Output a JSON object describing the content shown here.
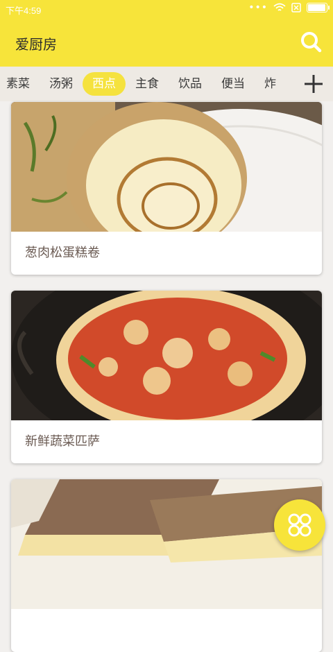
{
  "status_bar": {
    "time": "下午4:59",
    "dots": "•••",
    "battery_level": 0.95
  },
  "app": {
    "title": "爱厨房"
  },
  "tabs": [
    {
      "label": "素菜",
      "active": false
    },
    {
      "label": "汤粥",
      "active": false
    },
    {
      "label": "西点",
      "active": true
    },
    {
      "label": "主食",
      "active": false
    },
    {
      "label": "饮品",
      "active": false
    },
    {
      "label": "便当",
      "active": false
    },
    {
      "label": "炸",
      "active": false
    }
  ],
  "recipes": [
    {
      "title": "葱肉松蛋糕卷"
    },
    {
      "title": "新鲜蔬菜匹萨"
    },
    {
      "title": ""
    }
  ],
  "colors": {
    "accent": "#f7e43a",
    "active_tab": "#f5e23e",
    "tab_bar": "#eeeae4",
    "recipe_text": "#6a5a52"
  },
  "icons": {
    "search": "search-icon",
    "add": "plus-icon",
    "fab": "clover-icon",
    "wifi": "wifi-icon",
    "sim": "sim-icon",
    "battery": "battery-icon"
  }
}
